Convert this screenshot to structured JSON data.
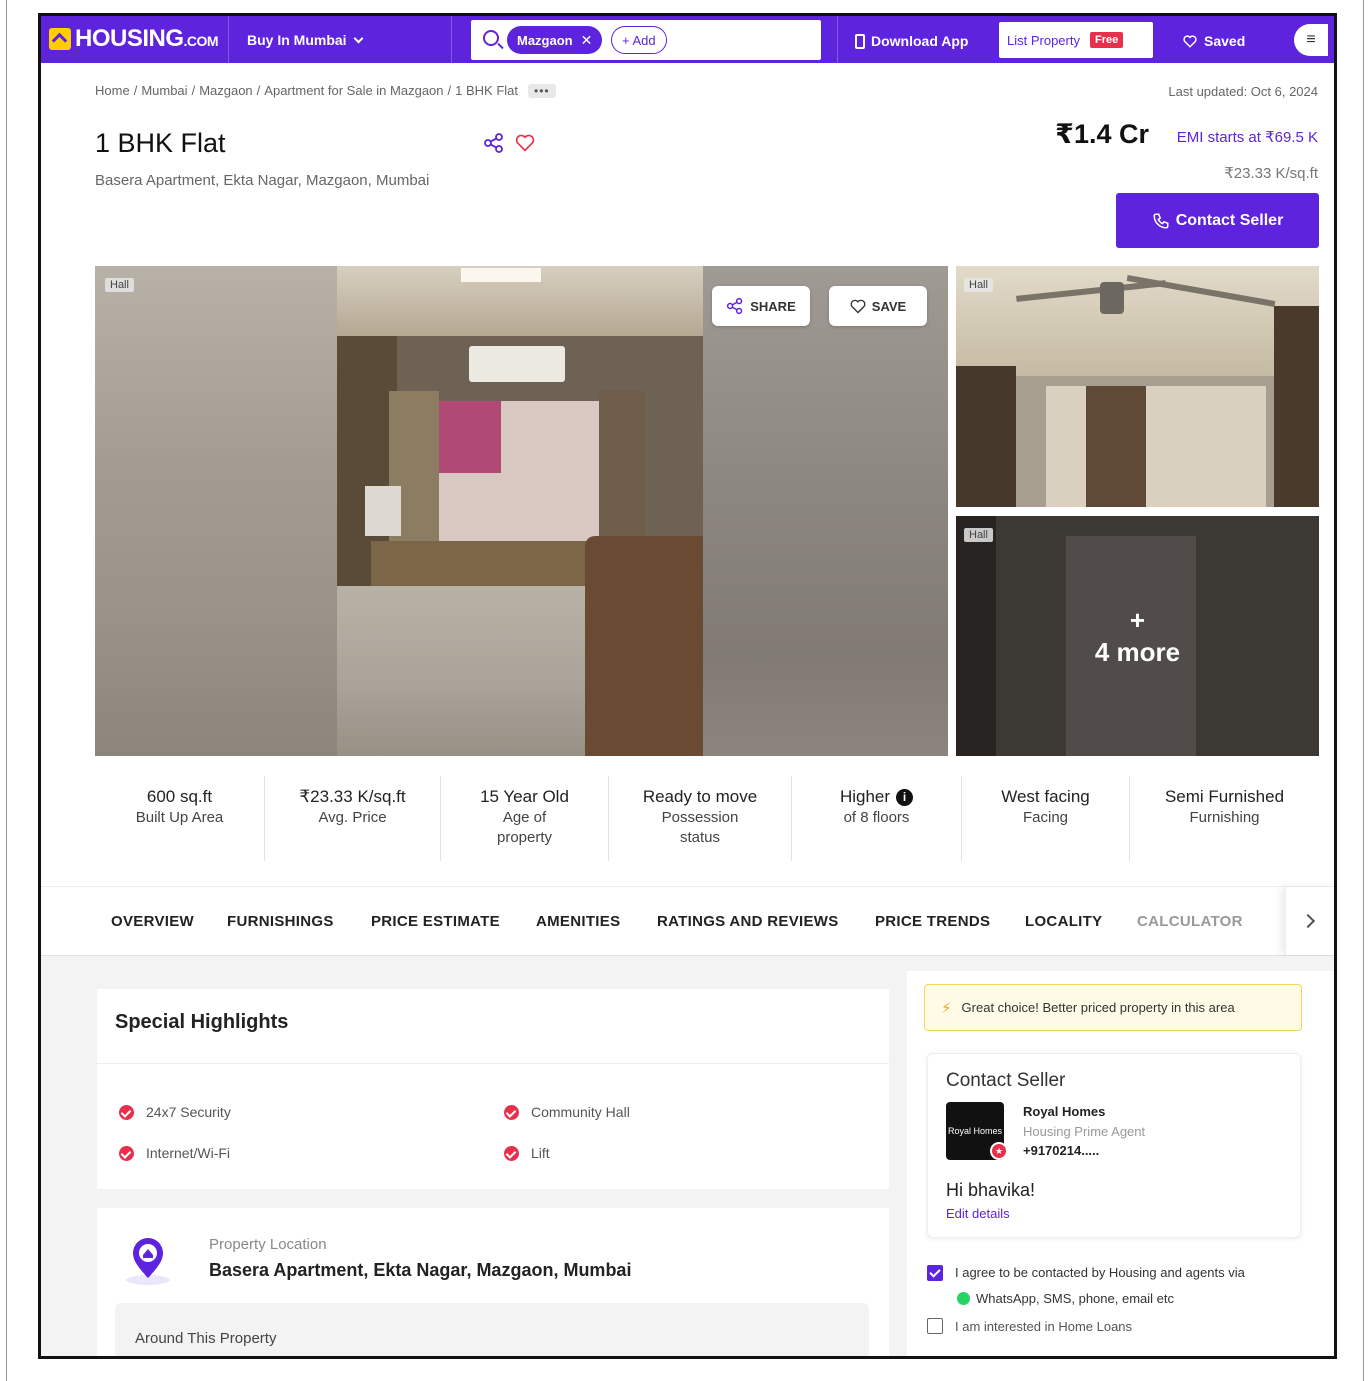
{
  "nav": {
    "logo_main": "HOUSING",
    "logo_suffix": ".COM",
    "city_selector": "Buy In Mumbai",
    "search_chip": "Mazgaon",
    "add_chip": "+ Add",
    "download_app": "Download App",
    "list_property": "List Property",
    "free_badge": "Free",
    "saved": "Saved",
    "menu_icon": "hamburger-icon"
  },
  "breadcrumb": [
    "Home",
    "Mumbai",
    "Mazgaon",
    "Apartment for Sale in Mazgaon",
    "1 BHK Flat"
  ],
  "breadcrumb_more": "•••",
  "last_updated": "Last updated: Oct 6, 2024",
  "listing": {
    "title": "1 BHK Flat",
    "address": "Basera Apartment, Ekta Nagar, Mazgaon, Mumbai",
    "price": "₹1.4 Cr",
    "emi": "EMI starts at ₹69.5 K",
    "price_per_sqft": "₹23.33 K/sq.ft",
    "contact_button": "Contact Seller"
  },
  "gallery": {
    "main_tag": "Hall",
    "share": "SHARE",
    "save": "SAVE",
    "side1_tag": "Hall",
    "side2_tag": "Hall",
    "more_plus": "+",
    "more_text": "4 more"
  },
  "specs": [
    {
      "value": "600 sq.ft",
      "label": "Built Up Area"
    },
    {
      "value": "₹23.33 K/sq.ft",
      "label": "Avg. Price"
    },
    {
      "value": "15 Year Old",
      "label": "Age of property"
    },
    {
      "value": "Ready to move",
      "label": "Possession status"
    },
    {
      "value": "Higher",
      "label": "of 8 floors"
    },
    {
      "value": "West facing",
      "label": "Facing"
    },
    {
      "value": "Semi Furnished",
      "label": "Furnishing"
    }
  ],
  "tabs": [
    "OVERVIEW",
    "FURNISHINGS",
    "PRICE ESTIMATE",
    "AMENITIES",
    "RATINGS AND REVIEWS",
    "PRICE TRENDS",
    "LOCALITY",
    "CALCULATOR"
  ],
  "highlights": {
    "title": "Special Highlights",
    "items": [
      "24x7 Security",
      "Community Hall",
      "Internet/Wi-Fi",
      "Lift"
    ]
  },
  "location": {
    "label": "Property Location",
    "address": "Basera Apartment, Ekta Nagar, Mazgaon, Mumbai",
    "around": "Around This Property"
  },
  "side": {
    "banner": "Great choice! Better priced property in this area",
    "contact_title": "Contact Seller",
    "seller_logo_text": "Royal Homes",
    "seller_name": "Royal Homes",
    "seller_role": "Housing Prime Agent",
    "seller_phone": "+9170214.....",
    "greeting": "Hi bhavika!",
    "edit_details": "Edit details",
    "agree_text": "I agree to be contacted by Housing and agents via",
    "agree_channels": "WhatsApp, SMS, phone, email etc",
    "loan_text": "I am interested in Home Loans"
  },
  "colors": {
    "brand": "#5e23dc",
    "accent_red": "#e8304d",
    "banner_yellow": "#fffbe6"
  }
}
